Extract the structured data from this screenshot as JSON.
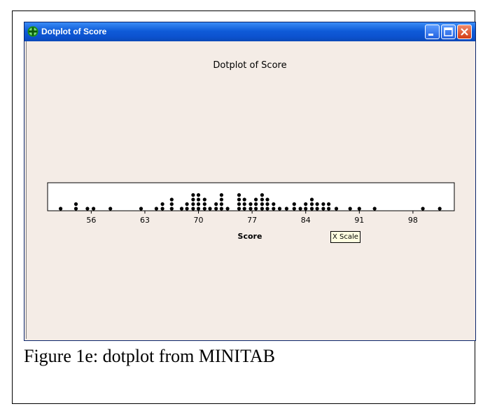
{
  "window": {
    "title": "Dotplot of Score",
    "icon": "minitab-graph-icon",
    "buttons": {
      "minimize": "minimize-icon",
      "maximize": "maximize-icon",
      "close": "close-icon"
    }
  },
  "chart_data": {
    "type": "dotplot",
    "title": "Dotplot of Score",
    "xlabel": "Score",
    "ylabel": "",
    "xlim": [
      50.3,
      103.4
    ],
    "tick_values": [
      56,
      63,
      70,
      77,
      84,
      91,
      98
    ],
    "tick_labels": [
      "56",
      "63",
      "70",
      "77",
      "84",
      "91",
      "98"
    ],
    "points": [
      {
        "x": 52,
        "count": 1
      },
      {
        "x": 54,
        "count": 2
      },
      {
        "x": 55.5,
        "count": 1
      },
      {
        "x": 56.3,
        "count": 1
      },
      {
        "x": 58.5,
        "count": 1
      },
      {
        "x": 62.5,
        "count": 1
      },
      {
        "x": 64.5,
        "count": 1
      },
      {
        "x": 65.3,
        "count": 2
      },
      {
        "x": 66.5,
        "count": 3
      },
      {
        "x": 67.8,
        "count": 1
      },
      {
        "x": 68.5,
        "count": 2
      },
      {
        "x": 69.3,
        "count": 4
      },
      {
        "x": 70,
        "count": 4
      },
      {
        "x": 70.8,
        "count": 3
      },
      {
        "x": 71.5,
        "count": 1
      },
      {
        "x": 72.3,
        "count": 2
      },
      {
        "x": 73,
        "count": 4
      },
      {
        "x": 73.8,
        "count": 1
      },
      {
        "x": 75.3,
        "count": 4
      },
      {
        "x": 76,
        "count": 3
      },
      {
        "x": 76.8,
        "count": 2
      },
      {
        "x": 77.5,
        "count": 3
      },
      {
        "x": 78.3,
        "count": 4
      },
      {
        "x": 79,
        "count": 3
      },
      {
        "x": 79.8,
        "count": 2
      },
      {
        "x": 80.6,
        "count": 1
      },
      {
        "x": 81.5,
        "count": 1
      },
      {
        "x": 82.5,
        "count": 2
      },
      {
        "x": 83.3,
        "count": 1
      },
      {
        "x": 84,
        "count": 2
      },
      {
        "x": 84.8,
        "count": 3
      },
      {
        "x": 85.5,
        "count": 2
      },
      {
        "x": 86.3,
        "count": 2
      },
      {
        "x": 87,
        "count": 2
      },
      {
        "x": 88,
        "count": 1
      },
      {
        "x": 89.8,
        "count": 1
      },
      {
        "x": 91,
        "count": 1
      },
      {
        "x": 93,
        "count": 1
      },
      {
        "x": 99.3,
        "count": 1
      },
      {
        "x": 101.5,
        "count": 1
      }
    ]
  },
  "tooltip": {
    "text": "X Scale"
  },
  "caption": "Figure 1e: dotplot from MINITAB",
  "colors": {
    "titlebar": "#0c52cf",
    "background": "#f4ece6",
    "plot_area": "#ffffff",
    "dots": "#000000",
    "tooltip_bg": "#ffffe1"
  }
}
